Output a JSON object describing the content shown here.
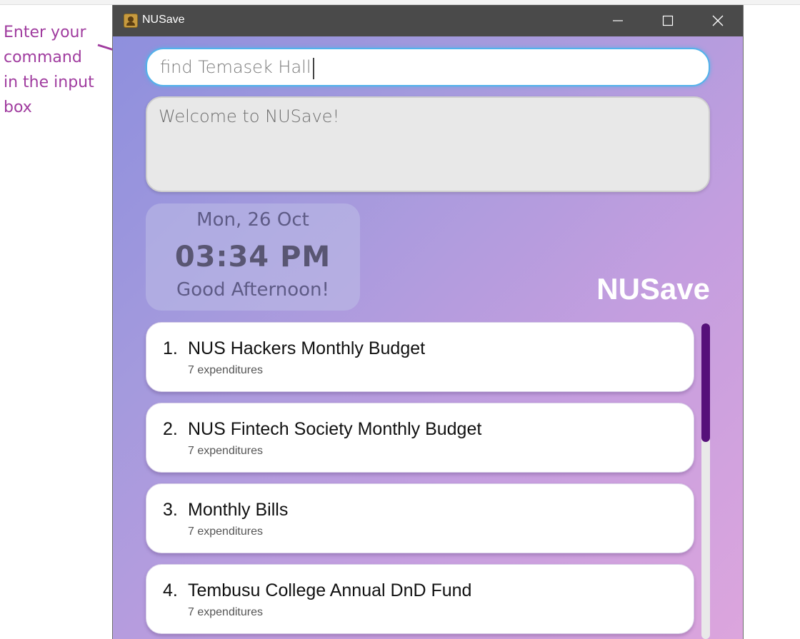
{
  "annotation": {
    "text": "Enter your\ncommand\nin the input\nbox",
    "color": "#a03c9f"
  },
  "window": {
    "title": "NUSave",
    "icon": "address-book-icon",
    "controls": [
      "minimize-icon",
      "maximize-icon",
      "close-icon"
    ]
  },
  "command": {
    "value": "find Temasek Hall"
  },
  "result": {
    "text": "Welcome to NUSave!"
  },
  "clock": {
    "date": "Mon, 26 Oct",
    "time": "03:34 PM",
    "greeting": "Good Afternoon!"
  },
  "brand": {
    "name": "NUSave"
  },
  "budgets": [
    {
      "index": "1.",
      "name": "NUS Hackers Monthly Budget",
      "count": "7 expenditures"
    },
    {
      "index": "2.",
      "name": "NUS Fintech Society Monthly Budget",
      "count": "7 expenditures"
    },
    {
      "index": "3.",
      "name": "Monthly Bills",
      "count": "7 expenditures"
    },
    {
      "index": "4.",
      "name": "Tembusu College Annual DnD Fund",
      "count": "7 expenditures"
    }
  ],
  "scrollbar": {
    "position_fraction": 0.0,
    "visible_fraction": 0.375
  },
  "colors": {
    "accent": "#53b2ea",
    "scroll_thumb": "#56107a",
    "titlebar": "#4a4a4a",
    "annotation": "#a03c9f"
  }
}
